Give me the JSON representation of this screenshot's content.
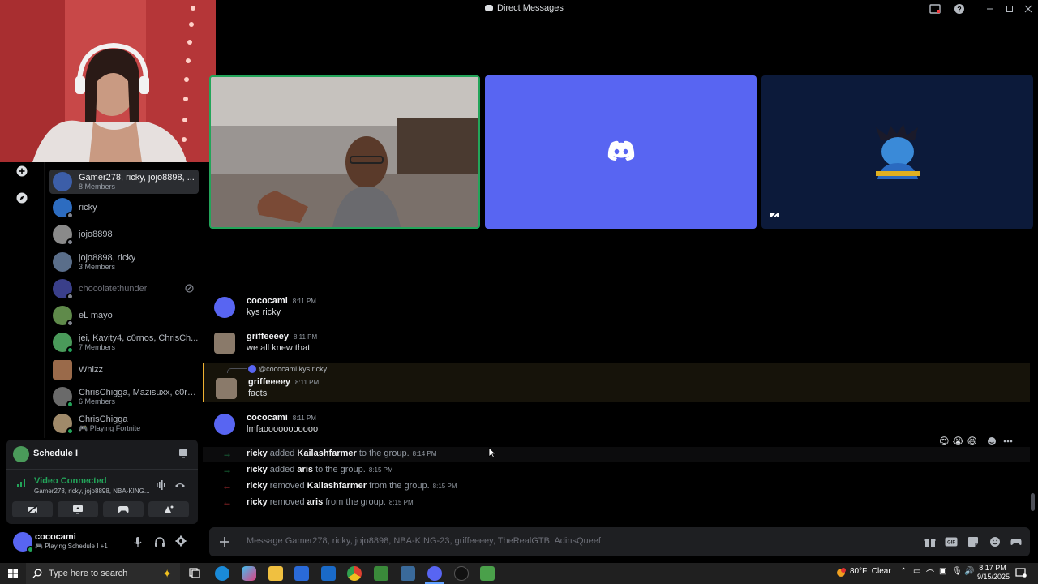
{
  "window": {
    "title": "Direct Messages"
  },
  "dm_list": [
    {
      "name": "Gamer278, ricky, jojo8898, ...",
      "sub": "8 Members",
      "active": true,
      "color": "#3c5ea8"
    },
    {
      "name": "ricky",
      "sub": "",
      "color": "#2d6cc0"
    },
    {
      "name": "jojo8898",
      "sub": "",
      "color": "#8a8a8a"
    },
    {
      "name": "jojo8898, ricky",
      "sub": "3 Members",
      "color": "#5a6e8a"
    },
    {
      "name": "chocolatethunder",
      "sub": "",
      "muted": true,
      "color": "#5865f2"
    },
    {
      "name": "eL mayo",
      "sub": "",
      "color": "#5f8a4a"
    },
    {
      "name": "jei, Kavity4, c0rnos, ChrisCh...",
      "sub": "7 Members",
      "color": "#4a9a5a"
    },
    {
      "name": "Whizz",
      "sub": "",
      "color": "#9a6a4a"
    },
    {
      "name": "ChrisChigga, Mazisuxx, c0rn...",
      "sub": "6 Members",
      "color": "#6a6a6a"
    },
    {
      "name": "ChrisChigga",
      "sub": "Playing Fortnite",
      "color": "#a08a6a"
    }
  ],
  "activity": {
    "title": "Schedule I"
  },
  "voice": {
    "status": "Video Connected",
    "channel": "Gamer278, ricky, jojo8898, NBA-KING..."
  },
  "user": {
    "name": "cococami",
    "status": "Playing Schedule I +1"
  },
  "messages": [
    {
      "author": "cococami",
      "time": "8:11 PM",
      "content": "kys ricky",
      "avatar": "discord"
    },
    {
      "author": "griffeeeey",
      "time": "8:11 PM",
      "content": "we all knew that",
      "avatar": "griff"
    },
    {
      "reply_to": "@cococami kys ricky",
      "author": "griffeeeey",
      "time": "8:11 PM",
      "content": "facts",
      "avatar": "griff"
    },
    {
      "author": "cococami",
      "time": "8:11 PM",
      "content": "lmfaooooooooooo",
      "avatar": "discord"
    }
  ],
  "system_messages": [
    {
      "actor": "ricky",
      "verb": "added",
      "target": "Kailashfarmer",
      "suffix": "to the group.",
      "time": "8:14 PM",
      "type": "add"
    },
    {
      "actor": "ricky",
      "verb": "added",
      "target": "aris",
      "suffix": "to the group.",
      "time": "8:15 PM",
      "type": "add"
    },
    {
      "actor": "ricky",
      "verb": "removed",
      "target": "Kailashfarmer",
      "suffix": "from the group.",
      "time": "8:15 PM",
      "type": "remove"
    },
    {
      "actor": "ricky",
      "verb": "removed",
      "target": "aris",
      "suffix": "from the group.",
      "time": "8:15 PM",
      "type": "remove"
    }
  ],
  "composer": {
    "placeholder": "Message Gamer278, ricky, jojo8898, NBA-KING-23, griffeeeey, TheRealGTB, AdinsQueef"
  },
  "reactions_bar": [
    "😍",
    "😭",
    "😆"
  ],
  "taskbar": {
    "search_placeholder": "Type here to search",
    "weather": "80°F  Clear",
    "time": "8:17 PM",
    "date": "9/15/2025"
  },
  "colors": {
    "blurple": "#5865f2",
    "green": "#23a55a",
    "red": "#f23f43",
    "tile_dark": "#0c1a3a"
  }
}
